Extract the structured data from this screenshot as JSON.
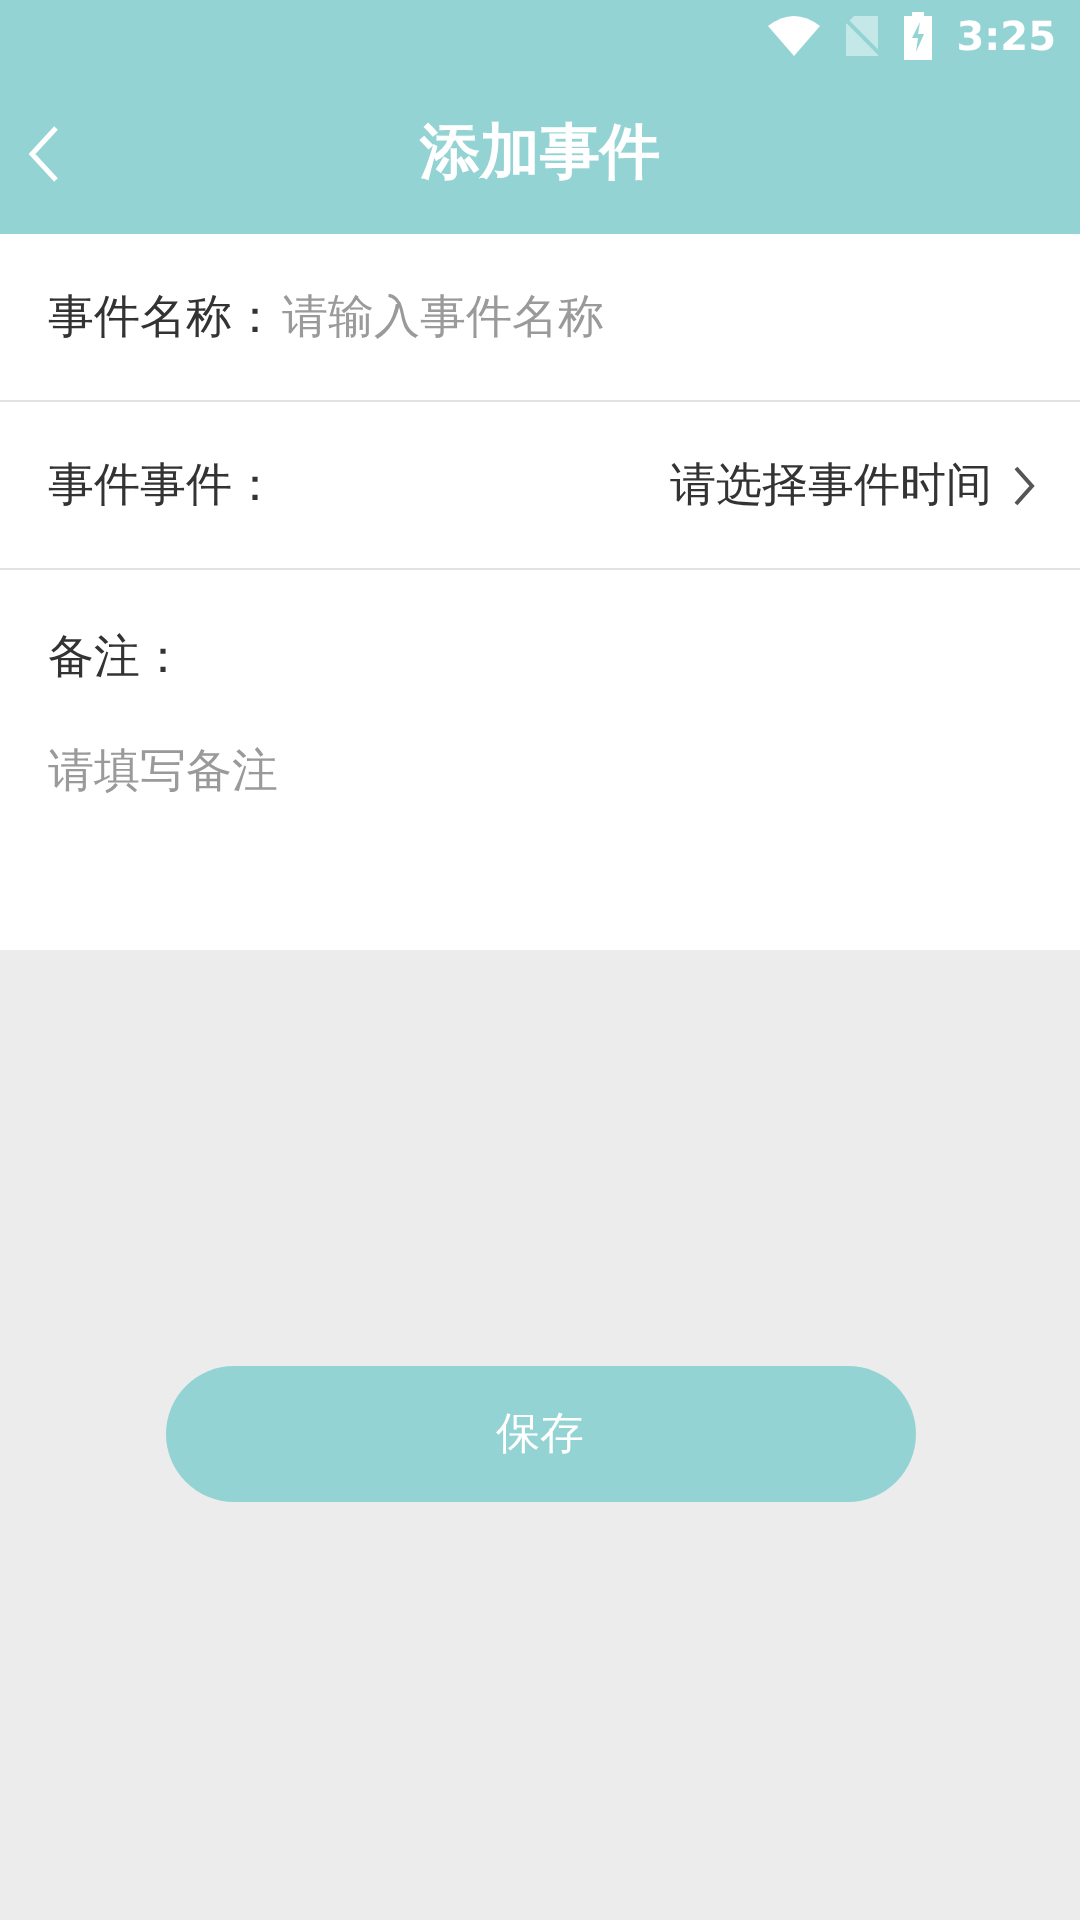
{
  "status_bar": {
    "time": "3:25"
  },
  "header": {
    "title": "添加事件"
  },
  "form": {
    "name_field": {
      "label": "事件名称：",
      "placeholder": "请输入事件名称"
    },
    "time_field": {
      "label": "事件事件：",
      "value": "请选择事件时间"
    },
    "notes_field": {
      "label": "备注：",
      "placeholder": "请填写备注"
    }
  },
  "save_button": {
    "label": "保存"
  }
}
